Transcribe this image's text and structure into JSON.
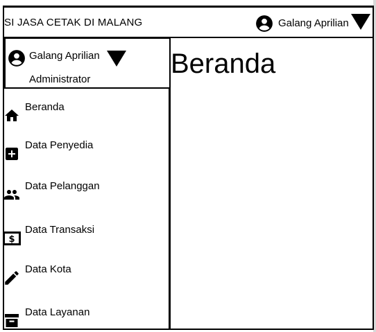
{
  "header": {
    "app_title": "SI JASA CETAK DI MALANG",
    "user_name": "Galang Aprilian"
  },
  "profile": {
    "name": "Galang Aprilian",
    "role": "Administrator"
  },
  "sidebar": {
    "items": [
      {
        "label": "Beranda",
        "icon": "home-icon"
      },
      {
        "label": "Data Penyedia",
        "icon": "add-box-icon"
      },
      {
        "label": "Data Pelanggan",
        "icon": "people-icon"
      },
      {
        "label": "Data Transaksi",
        "icon": "money-icon"
      },
      {
        "label": "Data Kota",
        "icon": "pencil-icon"
      },
      {
        "label": "Data Layanan",
        "icon": "archive-icon"
      }
    ]
  },
  "main": {
    "page_title": "Beranda"
  }
}
